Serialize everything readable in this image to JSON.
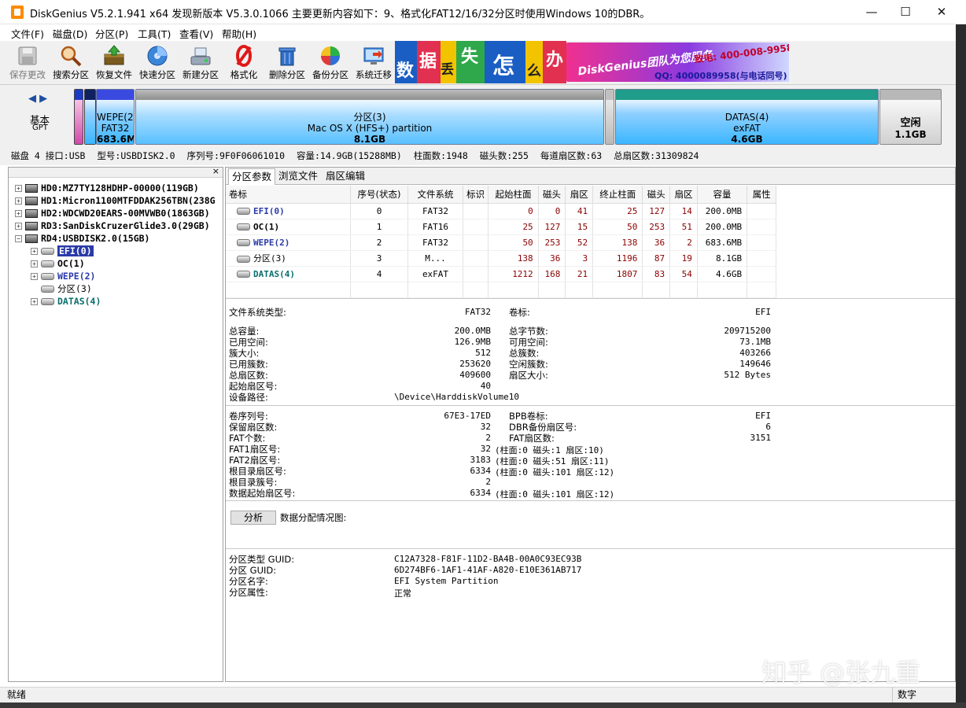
{
  "window": {
    "title": "DiskGenius V5.2.1.941 x64   发现新版本 V5.3.0.1066 主要更新内容如下：9、格式化FAT12/16/32分区时使用Windows 10的DBR。",
    "minimize": "—",
    "maximize": "☐",
    "close": "✕"
  },
  "menu": [
    "文件(F)",
    "磁盘(D)",
    "分区(P)",
    "工具(T)",
    "查看(V)",
    "帮助(H)"
  ],
  "toolbar": [
    {
      "label": "保存更改",
      "icon": "save-icon",
      "enabled": false
    },
    {
      "label": "搜索分区",
      "icon": "search-icon",
      "enabled": true
    },
    {
      "label": "恢复文件",
      "icon": "recover-icon",
      "enabled": true
    },
    {
      "label": "快速分区",
      "icon": "quick-partition-icon",
      "enabled": true
    },
    {
      "label": "新建分区",
      "icon": "new-partition-icon",
      "enabled": true
    },
    {
      "label": "格式化",
      "icon": "format-icon",
      "enabled": true
    },
    {
      "label": "删除分区",
      "icon": "delete-icon",
      "enabled": true
    },
    {
      "label": "备份分区",
      "icon": "backup-icon",
      "enabled": true
    },
    {
      "label": "系统迁移",
      "icon": "migrate-icon",
      "enabled": true
    }
  ],
  "banner": {
    "chars": [
      "数",
      "据",
      "丢",
      "失",
      "怎",
      "么",
      "办"
    ],
    "brand": "DiskGenius团队为您服务",
    "phone": "致电: 400-008-9958",
    "qq": "QQ: 4000089958(与电话同号)"
  },
  "diskmap": {
    "nav": "◀ ▶",
    "type": "基本",
    "scheme": "GPT",
    "segments": [
      {
        "name": "WEPE(2)",
        "fs": "FAT32",
        "size": "683.6MB"
      },
      {
        "name": "分区(3)",
        "fs": "Mac OS X (HFS+) partition",
        "size": "8.1GB"
      },
      {
        "name": "DATAS(4)",
        "fs": "exFAT",
        "size": "4.6GB"
      },
      {
        "name": "空闲",
        "size": "1.1GB"
      }
    ]
  },
  "diskinfo": [
    "磁盘 4 接口:USB",
    "型号:USBDISK2.0",
    "序列号:9F0F06061010",
    "容量:14.9GB(15288MB)",
    "柱面数:1948",
    "磁头数:255",
    "每道扇区数:63",
    "总扇区数:31309824"
  ],
  "tree": {
    "close": "×",
    "disks": [
      "HD0:MZ7TY128HDHP-00000(119GB)",
      "HD1:Micron1100MTFDDAK256TBN(238G",
      "HD2:WDCWD20EARS-00MVWB0(1863GB)",
      "RD3:SanDiskCruzerGlide3.0(29GB)",
      "RD4:USBDISK2.0(15GB)"
    ],
    "partitions": [
      "EFI(0)",
      "OC(1)",
      "WEPE(2)",
      "分区(3)",
      "DATAS(4)"
    ],
    "expand_plus": "+",
    "expand_minus": "−"
  },
  "tabs": [
    "分区参数",
    "浏览文件",
    "扇区编辑"
  ],
  "table": {
    "headers": [
      "卷标",
      "序号(状态)",
      "文件系统",
      "标识",
      "起始柱面",
      "磁头",
      "扇区",
      "终止柱面",
      "磁头",
      "扇区",
      "容量",
      "属性"
    ],
    "rows": [
      {
        "vol": "EFI(0)",
        "idx": "0",
        "fs": "FAT32",
        "flag": "",
        "sc": "0",
        "sh": "0",
        "ss": "41",
        "ec": "25",
        "eh": "127",
        "es": "14",
        "size": "200.0MB",
        "attr": "",
        "color": "#2a3aa8"
      },
      {
        "vol": "OC(1)",
        "idx": "1",
        "fs": "FAT16",
        "flag": "",
        "sc": "25",
        "sh": "127",
        "ss": "15",
        "ec": "50",
        "eh": "253",
        "es": "51",
        "size": "200.0MB",
        "attr": "",
        "color": "#000000"
      },
      {
        "vol": "WEPE(2)",
        "idx": "2",
        "fs": "FAT32",
        "flag": "",
        "sc": "50",
        "sh": "253",
        "ss": "52",
        "ec": "138",
        "eh": "36",
        "es": "2",
        "size": "683.6MB",
        "attr": "",
        "color": "#2a3aa8"
      },
      {
        "vol": "分区(3)",
        "idx": "3",
        "fs": "M...",
        "flag": "",
        "sc": "138",
        "sh": "36",
        "ss": "3",
        "ec": "1196",
        "eh": "87",
        "es": "19",
        "size": "8.1GB",
        "attr": "",
        "color": "#000000"
      },
      {
        "vol": "DATAS(4)",
        "idx": "4",
        "fs": "exFAT",
        "flag": "",
        "sc": "1212",
        "sh": "168",
        "ss": "21",
        "ec": "1807",
        "eh": "83",
        "es": "54",
        "size": "4.6GB",
        "attr": "",
        "color": "#0a6e6e"
      }
    ]
  },
  "fsinfo": {
    "fs_label": "文件系统类型:",
    "fs_value": "FAT32",
    "vol_label": "卷标:",
    "vol_value": "EFI",
    "left": [
      {
        "k": "总容量:",
        "v": "200.0MB"
      },
      {
        "k": "已用空间:",
        "v": "126.9MB"
      },
      {
        "k": "簇大小:",
        "v": "512"
      },
      {
        "k": "已用簇数:",
        "v": "253620"
      },
      {
        "k": "总扇区数:",
        "v": "409600"
      },
      {
        "k": "起始扇区号:",
        "v": "40"
      }
    ],
    "right": [
      {
        "k": "总字节数:",
        "v": "209715200"
      },
      {
        "k": "可用空间:",
        "v": "73.1MB"
      },
      {
        "k": "总簇数:",
        "v": "403266"
      },
      {
        "k": "空闲簇数:",
        "v": "149646"
      },
      {
        "k": "扇区大小:",
        "v": "512 Bytes"
      }
    ],
    "device_label": "设备路径:",
    "device_value": "\\Device\\HarddiskVolume10"
  },
  "bpb": {
    "left": [
      {
        "k": "卷序列号:",
        "v": "67E3-17ED"
      },
      {
        "k": "保留扇区数:",
        "v": "32"
      },
      {
        "k": "FAT个数:",
        "v": "2"
      },
      {
        "k": "FAT1扇区号:",
        "v": "32"
      },
      {
        "k": "FAT2扇区号:",
        "v": "3183"
      },
      {
        "k": "根目录扇区号:",
        "v": "6334"
      },
      {
        "k": "根目录簇号:",
        "v": "2"
      },
      {
        "k": "数据起始扇区号:",
        "v": "6334"
      }
    ],
    "right_top": [
      {
        "k": "BPB卷标:",
        "v": "EFI"
      },
      {
        "k": "DBR备份扇区号:",
        "v": "6"
      },
      {
        "k": "FAT扇区数:",
        "v": "3151"
      }
    ],
    "chs": [
      "(柱面:0 磁头:1 扇区:10)",
      "(柱面:0 磁头:51 扇区:11)",
      "(柱面:0 磁头:101 扇区:12)",
      "(柱面:0 磁头:101 扇区:12)"
    ]
  },
  "analyze": {
    "button": "分析",
    "label": "数据分配情况图:"
  },
  "guid": [
    {
      "k": "分区类型 GUID:",
      "v": "C12A7328-F81F-11D2-BA4B-00A0C93EC93B"
    },
    {
      "k": "分区 GUID:",
      "v": "6D274BF6-1AF1-41AF-A820-E10E361AB717"
    },
    {
      "k": "分区名字:",
      "v": "EFI System Partition"
    },
    {
      "k": "分区属性:",
      "v": "正常"
    }
  ],
  "status": {
    "left": "就绪",
    "right": "数字"
  },
  "watermark": "知乎 @张九重"
}
